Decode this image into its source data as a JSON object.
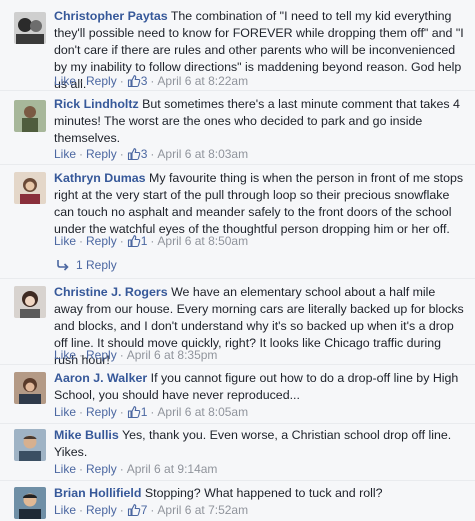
{
  "actions": {
    "like": "Like",
    "reply": "Reply",
    "separator": "·"
  },
  "comments": [
    {
      "author": "Christopher Paytas",
      "text": "The combination of \"I need to tell my kid everything they'll possible need to know for FOREVER while dropping them off\" and \"I don't care if there are rules and other parents who will be inconvenienced by my inability to follow directions\" is maddening beyond reason. God help us all.",
      "likes": "3",
      "time": "April 6 at 8:22am"
    },
    {
      "author": "Rick Lindholtz",
      "text": "But sometimes there's a last minute comment that takes 4 minutes! The worst are the ones who decided to park and go inside themselves.",
      "likes": "3",
      "time": "April 6 at 8:03am"
    },
    {
      "author": "Kathryn Dumas",
      "text": "My favourite thing is when the person in front of me stops right at the very start of the pull through loop so their precious snowflake can touch no asphalt and meander safely to the front doors of the school under the watchful eyes of the thoughtful person dropping him or her off.",
      "likes": "1",
      "time": "April 6 at 8:50am",
      "replies_label": "1 Reply"
    },
    {
      "author": "Christine J. Rogers",
      "text": "We have an elementary school about a half mile away from our house. Every morning cars are literally backed up for blocks and blocks, and I don't understand why it's so backed up when it's a drop off line. It should move quickly, right? It looks like Chicago traffic during rush hour!",
      "likes": "",
      "time": "April 6 at 8:35pm"
    },
    {
      "author": "Aaron J. Walker",
      "text": "If you cannot figure out how to do a drop-off line by High School, you should have never reproduced...",
      "likes": "1",
      "time": "April 6 at 8:05am"
    },
    {
      "author": "Mike Bullis",
      "text": "Yes, thank you. Even worse, a Christian school drop off line. Yikes.",
      "likes": "",
      "time": "April 6 at 9:14am"
    },
    {
      "author": "Brian Hollifield",
      "text": "Stopping? What happened to tuck and roll?",
      "likes": "7",
      "time": "April 6 at 7:52am"
    }
  ]
}
